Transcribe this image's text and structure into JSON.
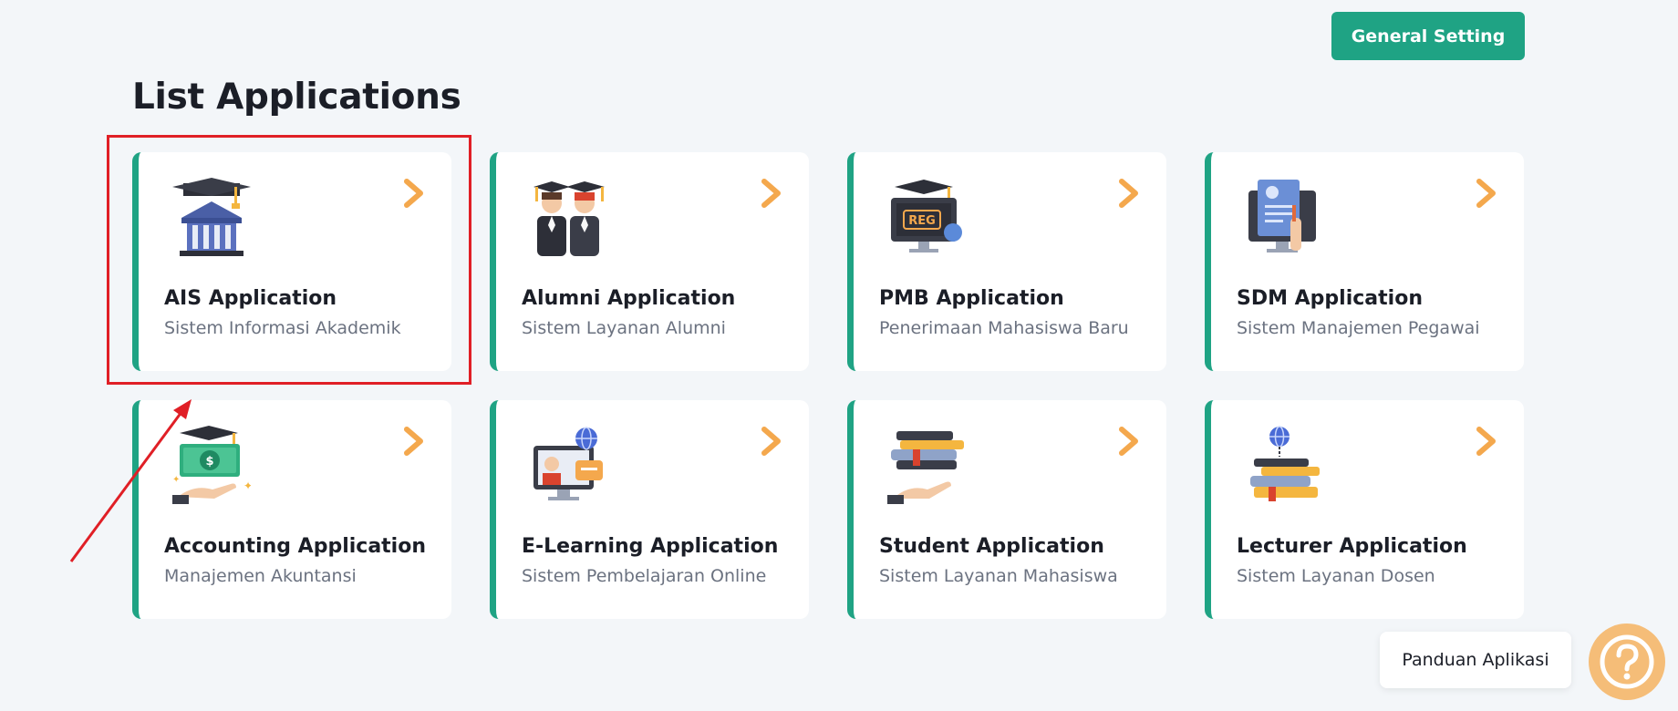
{
  "header": {
    "general_setting_label": "General Setting"
  },
  "page": {
    "title": "List Applications"
  },
  "apps": [
    {
      "title": "AIS Application",
      "subtitle": "Sistem Informasi Akademik",
      "icon": "university-icon"
    },
    {
      "title": "Alumni Application",
      "subtitle": "Sistem Layanan Alumni",
      "icon": "graduates-icon"
    },
    {
      "title": "PMB Application",
      "subtitle": "Penerimaan Mahasiswa Baru",
      "icon": "registration-monitor-icon",
      "icon_text": "REG"
    },
    {
      "title": "SDM Application",
      "subtitle": "Sistem Manajemen Pegawai",
      "icon": "employee-document-icon"
    },
    {
      "title": "Accounting Application",
      "subtitle": "Manajemen Akuntansi",
      "icon": "money-hand-icon"
    },
    {
      "title": "E-Learning Application",
      "subtitle": "Sistem Pembelajaran Online",
      "icon": "online-learning-icon"
    },
    {
      "title": "Student Application",
      "subtitle": "Sistem Layanan Mahasiswa",
      "icon": "books-hand-icon"
    },
    {
      "title": "Lecturer Application",
      "subtitle": "Sistem Layanan Dosen",
      "icon": "books-globe-icon"
    }
  ],
  "help": {
    "label": "Panduan Aplikasi",
    "icon": "question-icon"
  },
  "colors": {
    "accent": "#1fa384",
    "chevron": "#f4a84d",
    "highlight": "#e01f26",
    "help": "#f5bd78"
  }
}
